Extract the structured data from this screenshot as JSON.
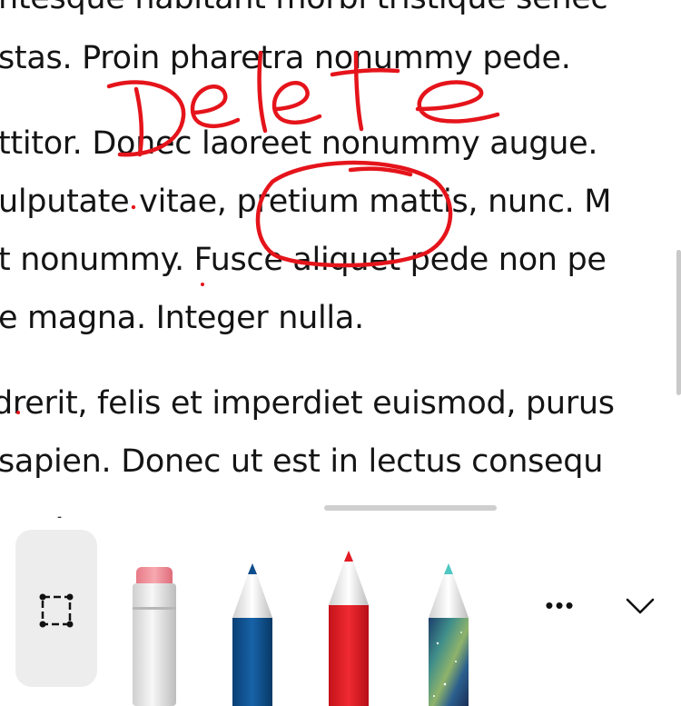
{
  "document": {
    "lines": [
      "ntesque habitant morbi tristique senec",
      "stas. Proin pharetra nonummy pede.",
      "ttitor. Donec laoreet nonummy augue.",
      "ulputate vitae, pretium mattis, nunc. M",
      "t nonummy. Fusce aliquet pede non pe",
      "e magna. Integer nulla.",
      "drerit, felis et imperdiet euismod, purus",
      "sapien. Donec ut est in lectus consequ"
    ]
  },
  "annotation": {
    "handwritten_text": "Delete",
    "ink_color": "#e5141b",
    "circled_word": "pretium"
  },
  "toolbar": {
    "tools": [
      {
        "name": "lasso-select",
        "icon": "lasso-select-icon",
        "selected": true
      },
      {
        "name": "eraser",
        "icon": "eraser-icon"
      },
      {
        "name": "pen-blue",
        "icon": "pen-icon",
        "color": "#0e4d8c"
      },
      {
        "name": "pen-red",
        "icon": "pen-icon",
        "color": "#e31b23"
      },
      {
        "name": "pen-galaxy",
        "icon": "pen-icon",
        "color": "#2f6e8f"
      }
    ],
    "more_icon": "ellipsis-icon",
    "collapse_icon": "chevron-down-icon"
  }
}
